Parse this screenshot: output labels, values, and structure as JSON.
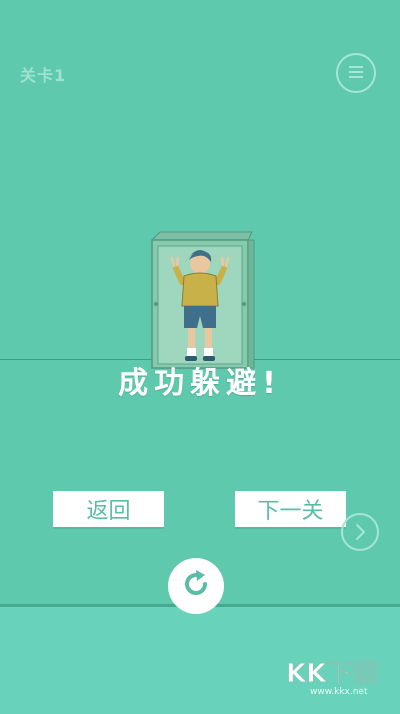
{
  "hud": {
    "level_label": "关卡1",
    "menu_icon": "menu-icon"
  },
  "result": {
    "message": "成功躲避!"
  },
  "buttons": {
    "back_label": "返回",
    "next_label": "下一关",
    "retry_icon": "refresh-icon",
    "next_arrow_icon": "chevron-right-icon"
  },
  "watermark": {
    "text": "KK下载",
    "url": "www.kkx.net"
  },
  "colors": {
    "background": "#5fc9ad",
    "ground": "#68d2bb",
    "button": "#ffffff",
    "button_text": "#5bbda5"
  }
}
